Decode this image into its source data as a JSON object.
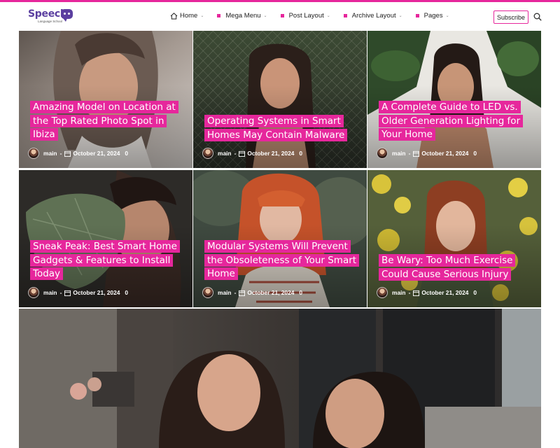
{
  "brand": {
    "name": "Speech",
    "tagline": "Language School"
  },
  "nav": {
    "items": [
      {
        "label": "Home"
      },
      {
        "label": "Mega Menu"
      },
      {
        "label": "Post Layout"
      },
      {
        "label": "Archive Layout"
      },
      {
        "label": "Pages"
      }
    ],
    "subscribe_label": "Subscribe"
  },
  "colors": {
    "accent": "#e6279c",
    "brand": "#5b3fa0"
  },
  "posts": [
    {
      "title": "Amazing Model on Location at the Top Rated Photo Spot in Ibiza",
      "author": "main",
      "date": "October 21, 2024",
      "comments": "0"
    },
    {
      "title": "Operating Systems in Smart Homes May Contain Malware",
      "author": "main",
      "date": "October 21, 2024",
      "comments": "0"
    },
    {
      "title": "A Complete Guide to LED vs. Older Generation Lighting for Your Home",
      "author": "main",
      "date": "October 21, 2024",
      "comments": "0"
    },
    {
      "title": "Sneak Peak: Best Smart Home Gadgets & Features to Install Today",
      "author": "main",
      "date": "October 21, 2024",
      "comments": "0"
    },
    {
      "title": "Modular Systems Will Prevent the Obsoleteness of Your Smart Home",
      "author": "main",
      "date": "October 21, 2024",
      "comments": "0"
    },
    {
      "title": "Be Wary: Too Much Exercise Could Cause Serious Injury",
      "author": "main",
      "date": "October 21, 2024",
      "comments": "0"
    }
  ]
}
